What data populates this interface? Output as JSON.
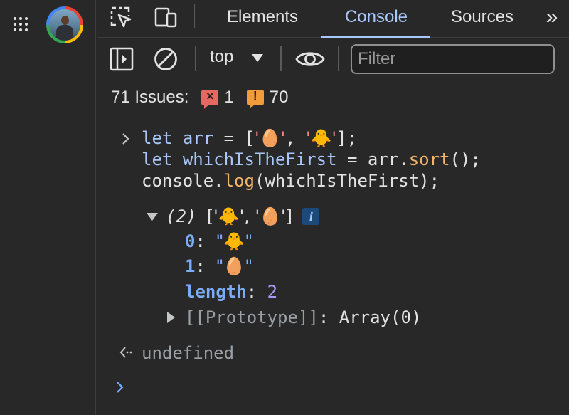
{
  "tabs": {
    "elements": "Elements",
    "console": "Console",
    "sources": "Sources",
    "overflow": "»"
  },
  "toolbar": {
    "context": "top",
    "filter_placeholder": "Filter"
  },
  "issues": {
    "label": "71 Issues:",
    "errors": "1",
    "warnings": "70"
  },
  "console": {
    "input_line1": {
      "kw": "let",
      "var": "arr",
      "op": " = [",
      "s1": "'🥚'",
      "comma": ", ",
      "s2": "'🐥'",
      "end": "];"
    },
    "input_line2": {
      "kw": "let",
      "var": "whichIsTheFirst",
      "op": " = arr.",
      "fn": "sort",
      "end": "();"
    },
    "input_line3": {
      "obj": "console.",
      "fn": "log",
      "end": "(whichIsTheFirst);"
    },
    "result": {
      "summary_count": "(2)",
      "summary_items": "['🐥', '🥚']",
      "info": "i",
      "entries": [
        {
          "key": "0",
          "value": "\"🐥\""
        },
        {
          "key": "1",
          "value": "\"🥚\""
        }
      ],
      "length_key": "length",
      "length_value": "2",
      "prototype_key": "[[Prototype]]",
      "prototype_value": "Array(0)"
    },
    "return_value": "undefined"
  },
  "colors": {
    "accent": "#a8c7fa",
    "background": "#282828",
    "error": "#e46962",
    "warning": "#f29b3b"
  },
  "icons": {
    "apps": "apps-grid-icon",
    "inspect": "inspect-element-icon",
    "device": "device-toolbar-icon",
    "sidebar": "show-sidebar-icon",
    "clear": "clear-console-icon",
    "eye": "live-expression-icon",
    "prompt": "chevron-right-icon",
    "return": "return-arrow-icon"
  }
}
